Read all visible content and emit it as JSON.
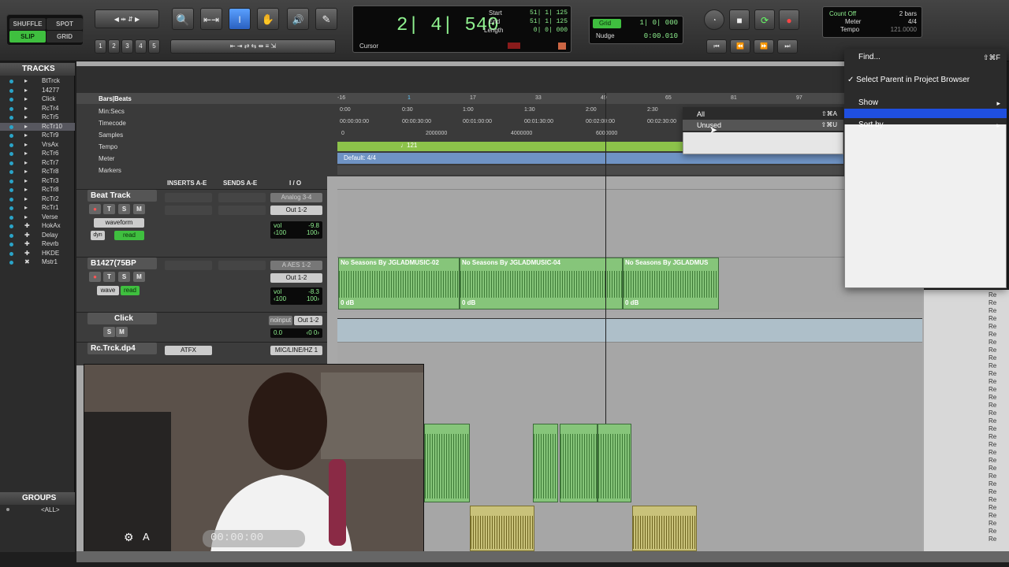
{
  "toolbar": {
    "modes": [
      "SHUFFLE",
      "SPOT",
      "SLIP",
      "GRID"
    ],
    "active_mode": "SLIP",
    "zoom_presets": [
      "1",
      "2",
      "3",
      "4",
      "5"
    ],
    "counter": {
      "main": "2| 4| 540",
      "start_label": "Start",
      "end_label": "End",
      "length_label": "Length",
      "start": "51| 1| 125",
      "end": "51| 1| 125",
      "length": "0| 0| 000",
      "cursor_label": "Cursor"
    },
    "grid": {
      "label": "Grid",
      "value": "1| 0| 000"
    },
    "nudge": {
      "label": "Nudge",
      "value": "0:00.010"
    },
    "count_off": "Count Off",
    "count_off_value": "2 bars",
    "meter_label": "Meter",
    "meter_value": "4/4",
    "tempo_label": "Tempo",
    "tempo_value": "121.0000"
  },
  "tracks_panel": {
    "title": "TRACKS",
    "items": [
      {
        "icon": "▸",
        "name": "BtTrck"
      },
      {
        "icon": "▸",
        "name": "14277"
      },
      {
        "icon": "▸",
        "name": "Click"
      },
      {
        "icon": "▸",
        "name": "RcTr4"
      },
      {
        "icon": "▸",
        "name": "RcTr5"
      },
      {
        "icon": "▸",
        "name": "RcTr10"
      },
      {
        "icon": "▸",
        "name": "RcTr9"
      },
      {
        "icon": "▸",
        "name": "VrsAx"
      },
      {
        "icon": "▸",
        "name": "RcTr6"
      },
      {
        "icon": "▸",
        "name": "RcTr7"
      },
      {
        "icon": "▸",
        "name": "RcTr8"
      },
      {
        "icon": "▸",
        "name": "RcTr3"
      },
      {
        "icon": "▸",
        "name": "RcTr8"
      },
      {
        "icon": "▸",
        "name": "RcTr2"
      },
      {
        "icon": "▸",
        "name": "RcTr1"
      },
      {
        "icon": "▸",
        "name": "Verse"
      },
      {
        "icon": "✚",
        "name": "HokAx"
      },
      {
        "icon": "✚",
        "name": "Delay"
      },
      {
        "icon": "✚",
        "name": "Revrb"
      },
      {
        "icon": "✚",
        "name": "HKDE"
      },
      {
        "icon": "✖",
        "name": "Mstr1"
      }
    ]
  },
  "groups_panel": {
    "title": "GROUPS",
    "items": [
      "<ALL>"
    ]
  },
  "rulers": {
    "labels": [
      "Bars|Beats",
      "Min:Secs",
      "Timecode",
      "Samples",
      "Tempo",
      "Meter",
      "Markers"
    ],
    "bars": [
      "-16",
      "1",
      "17",
      "33",
      "49",
      "65",
      "81",
      "97"
    ],
    "minsecs": [
      "0:00",
      "0:30",
      "1:00",
      "1:30",
      "2:00",
      "2:30"
    ],
    "timecode": [
      "00:00:00:00",
      "00:00:30:00",
      "00:01:00:00",
      "00:01:30:00",
      "00:02:00:00",
      "00:02:30:00"
    ],
    "samples": [
      "0",
      "2000000",
      "4000000",
      "6000000"
    ],
    "tempo_marker": "♩121",
    "meter_marker": "Default: 4/4"
  },
  "mix_header": {
    "inserts": "INSERTS A-E",
    "sends": "SENDS A-E",
    "io": "I / O"
  },
  "tracks": [
    {
      "name": "Beat Track",
      "input": "Analog 3-4",
      "output": "Out 1-2",
      "view": "waveform",
      "mode": "read",
      "vol": "-9.8",
      "pan_l": "‹100",
      "pan_r": "100›"
    },
    {
      "name": "B1427(75BP",
      "input": "A AES 1-2",
      "output": "Out 1-2",
      "view": "wave",
      "mode": "read",
      "vol": "-8.3",
      "pan_l": "‹100",
      "pan_r": "100›"
    },
    {
      "name": "Click",
      "input": "noinput",
      "output": "Out 1-2",
      "vol": "0.0",
      "pan": "‹0 0›"
    },
    {
      "name": "Rc.Trck.dp4",
      "insert": "ATFX",
      "output": "MIC/LINE/HZ 1"
    }
  ],
  "clips": [
    {
      "name": "No Seasons By JGLADMUSIC-02",
      "gain": "0 dB"
    },
    {
      "name": "No Seasons By JGLADMUSIC-04",
      "gain": "0 dB"
    },
    {
      "name": "No Seasons By JGLADMUS",
      "gain": "0 dB"
    }
  ],
  "menu": {
    "items": [
      {
        "label": "Find...",
        "shortcut": "⇧⌘F"
      },
      {
        "label": "Select Parent in Project Browser",
        "checked": true
      },
      {
        "label": "Show",
        "submenu": true
      },
      {
        "label": "",
        "highlighted": true
      },
      {
        "label": "Sort by",
        "submenu": true
      }
    ]
  },
  "submenu": {
    "items": [
      {
        "label": "All",
        "shortcut": "⇧⌘A"
      },
      {
        "label": "Unused",
        "shortcut": "⇧⌘U"
      }
    ]
  },
  "webcam": {
    "timer": "00:00:00"
  },
  "right_column": {
    "row_label": "Re"
  }
}
